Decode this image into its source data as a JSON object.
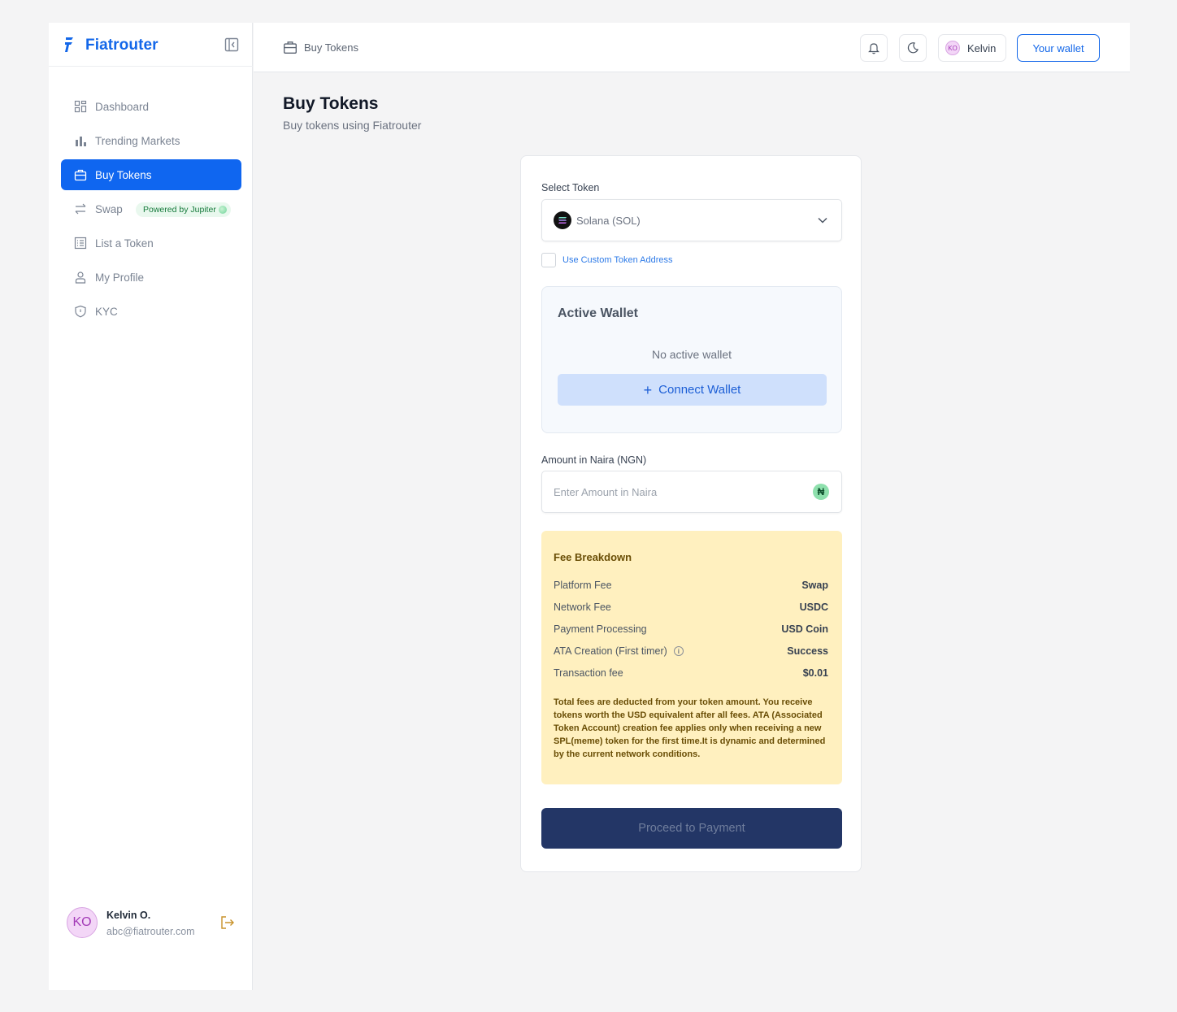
{
  "brand": {
    "name": "Fiatrouter"
  },
  "sidebar": {
    "items": [
      {
        "label": "Dashboard"
      },
      {
        "label": "Trending Markets"
      },
      {
        "label": "Buy Tokens"
      },
      {
        "label": "Swap",
        "badge": "Powered by Jupiter"
      },
      {
        "label": "List a Token"
      },
      {
        "label": "My Profile"
      },
      {
        "label": "KYC"
      }
    ],
    "user": {
      "initials": "KO",
      "name": "Kelvin O.",
      "email": "abc@fiatrouter.com"
    }
  },
  "topbar": {
    "breadcrumb": "Buy Tokens",
    "user_initials": "KO",
    "user_name": "Kelvin",
    "wallet_button": "Your wallet"
  },
  "page": {
    "title": "Buy Tokens",
    "subtitle": "Buy tokens using Fiatrouter"
  },
  "form": {
    "select_token_label": "Select Token",
    "selected_token": "Solana (SOL)",
    "custom_token_label": "Use Custom Token Address",
    "active_wallet": {
      "title": "Active Wallet",
      "status": "No active wallet",
      "connect_label": "Connect Wallet"
    },
    "amount_label": "Amount in Naira (NGN)",
    "amount_placeholder": "Enter Amount in Naira",
    "currency_symbol": "₦",
    "fee": {
      "title": "Fee Breakdown",
      "rows": [
        {
          "label": "Platform Fee",
          "value": "Swap"
        },
        {
          "label": "Network Fee",
          "value": "USDC"
        },
        {
          "label": "Payment Processing",
          "value": "USD Coin"
        },
        {
          "label": "ATA Creation (First timer)",
          "value": "Success"
        },
        {
          "label": "Transaction fee",
          "value": "$0.01"
        }
      ],
      "note": "Total fees are deducted from your token amount. You receive tokens worth the USD equivalent after all fees. ATA (Associated Token Account) creation fee applies only when receiving a new SPL(meme) token for the first time.It is dynamic and determined by the current network conditions."
    },
    "proceed_label": "Proceed to Payment"
  },
  "colors": {
    "accent": "#0f66f0",
    "fee_bg": "#fff0bf",
    "proceed_bg": "#233666"
  }
}
